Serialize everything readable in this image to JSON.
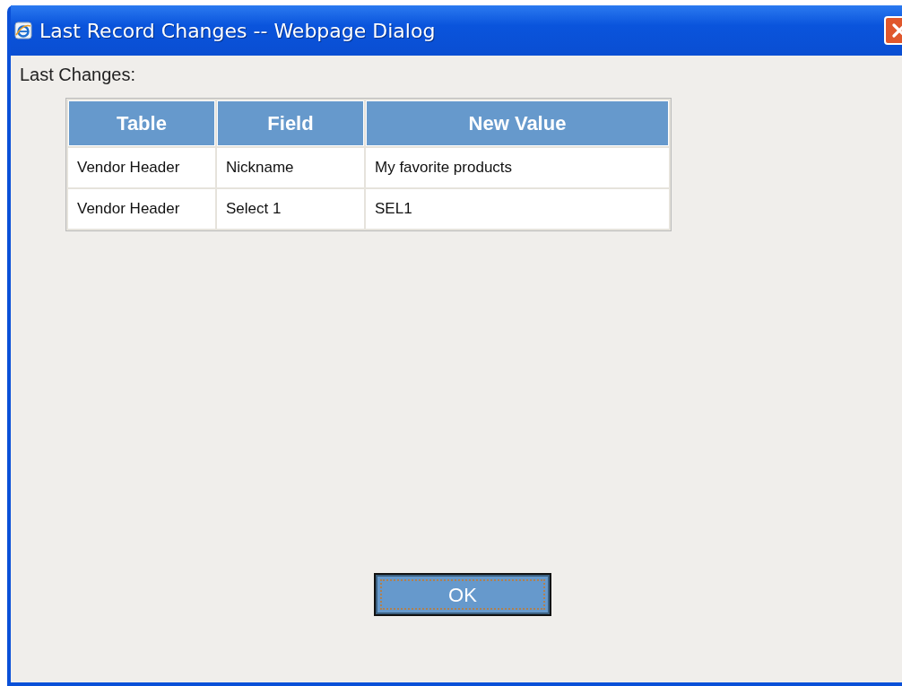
{
  "window": {
    "title": "Last Record Changes -- Webpage Dialog"
  },
  "heading": "Last Changes:",
  "table": {
    "columns": [
      "Table",
      "Field",
      "New Value"
    ],
    "rows": [
      [
        "Vendor Header",
        "Nickname",
        "My favorite products"
      ],
      [
        "Vendor Header",
        "Select 1",
        "SEL1"
      ]
    ]
  },
  "buttons": [
    "OK"
  ]
}
